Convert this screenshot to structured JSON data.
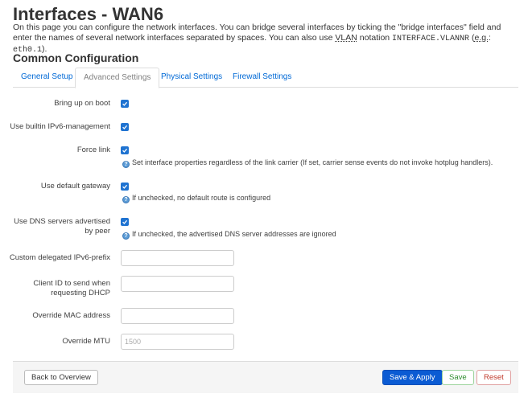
{
  "page": {
    "title": "Interfaces - WAN6",
    "description_1": "On this page you can configure the network interfaces. You can bridge several interfaces by ticking the \"bridge interfaces\" field and enter the names of several network interfaces separated by spaces. You can also use ",
    "description_vlan": "VLAN",
    "description_2": " notation ",
    "description_code": "INTERFACE.VLANNR",
    "description_3": " (",
    "description_eg": "e.g.",
    "description_4": ": ",
    "description_example": "eth0.1",
    "description_5": ")."
  },
  "section": {
    "title": "Common Configuration"
  },
  "tabs": [
    {
      "label": "General Setup",
      "active": false
    },
    {
      "label": "Advanced Settings",
      "active": true
    },
    {
      "label": "Physical Settings",
      "active": false
    },
    {
      "label": "Firewall Settings",
      "active": false
    }
  ],
  "fields": {
    "bring_up_on_boot": {
      "label": "Bring up on boot",
      "checked": true
    },
    "builtin_ipv6": {
      "label": "Use builtin IPv6-management",
      "checked": true
    },
    "force_link": {
      "label": "Force link",
      "checked": true,
      "help": "Set interface properties regardless of the link carrier (If set, carrier sense events do not invoke hotplug handlers)."
    },
    "default_gateway": {
      "label": "Use default gateway",
      "checked": true,
      "help": "If unchecked, no default route is configured"
    },
    "peer_dns": {
      "label_1": "Use DNS servers advertised",
      "label_2": "by peer",
      "checked": true,
      "help": "If unchecked, the advertised DNS server addresses are ignored"
    },
    "ip6prefix": {
      "label": "Custom delegated IPv6-prefix",
      "value": "",
      "placeholder": ""
    },
    "client_id": {
      "label_1": "Client ID to send when",
      "label_2": "requesting DHCP",
      "value": "",
      "placeholder": ""
    },
    "macaddr": {
      "label": "Override MAC address",
      "value": "",
      "placeholder": ""
    },
    "mtu": {
      "label": "Override MTU",
      "value": "",
      "placeholder": "1500"
    }
  },
  "icons": {
    "help": "help-icon",
    "help_glyph": "?",
    "checkbox": "checkmark-icon"
  },
  "footer": {
    "back_label": "Back to Overview",
    "save_apply_label": "Save & Apply",
    "save_label": "Save",
    "reset_label": "Reset"
  },
  "colors": {
    "link": "#0069d6",
    "primary": "#0b5bd3",
    "checkbox": "#1f73d1",
    "save": "#2e8b2e",
    "reset": "#c0392b"
  }
}
